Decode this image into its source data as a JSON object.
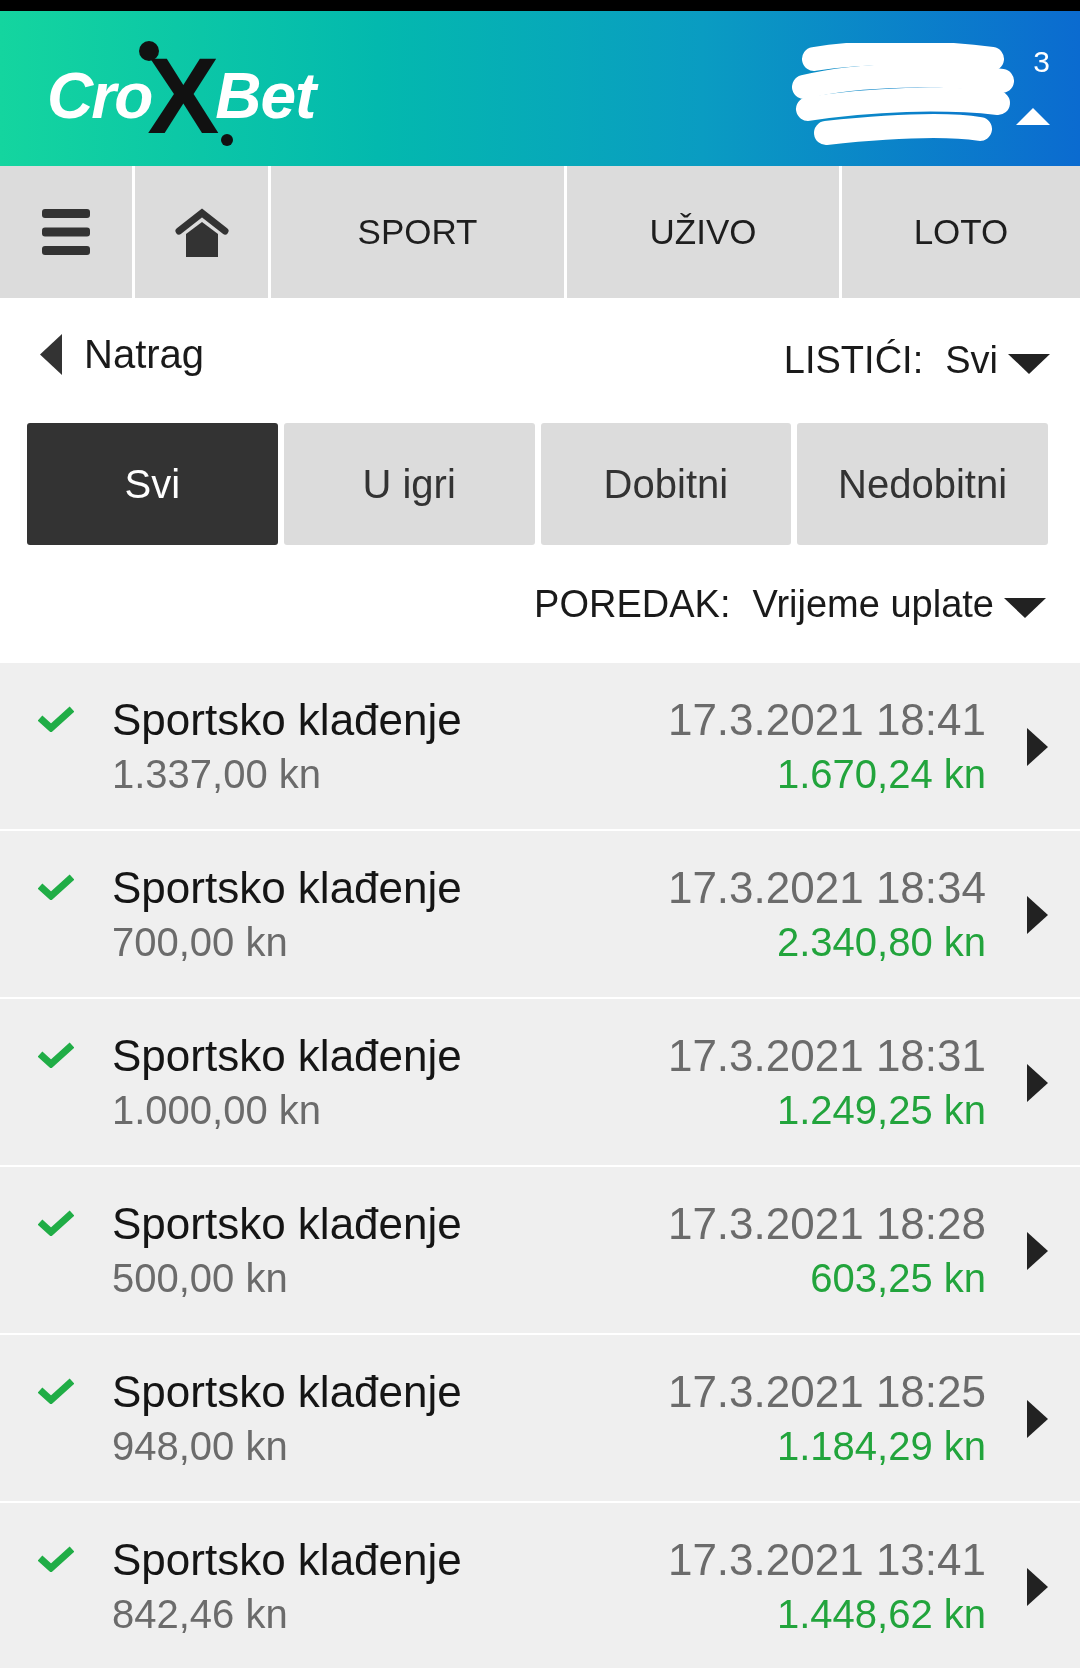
{
  "header": {
    "logo": {
      "prefix": "Cro",
      "mark": "X",
      "suffix": "Bet"
    },
    "redacted_account": {
      "visible_text": "3"
    }
  },
  "nav": [
    {
      "kind": "menu"
    },
    {
      "kind": "home"
    },
    {
      "kind": "link",
      "label": "SPORT"
    },
    {
      "kind": "link",
      "label": "UŽIVO"
    },
    {
      "kind": "link",
      "label": "LOTO"
    }
  ],
  "back": {
    "label": "Natrag"
  },
  "slip_filter": {
    "label": "LISTIĆI:",
    "value": "Svi"
  },
  "filter_tabs": [
    {
      "label": "Svi",
      "selected": true
    },
    {
      "label": "U igri",
      "selected": false
    },
    {
      "label": "Dobitni",
      "selected": false
    },
    {
      "label": "Nedobitni",
      "selected": false
    }
  ],
  "sort": {
    "label": "POREDAK:",
    "value": "Vrijeme uplate"
  },
  "slips": [
    {
      "title": "Sportsko klađenje",
      "stake": "1.337,00 kn",
      "time": "17.3.2021 18:41",
      "payout": "1.670,24 kn",
      "won": true
    },
    {
      "title": "Sportsko klađenje",
      "stake": "700,00 kn",
      "time": "17.3.2021 18:34",
      "payout": "2.340,80 kn",
      "won": true
    },
    {
      "title": "Sportsko klađenje",
      "stake": "1.000,00 kn",
      "time": "17.3.2021 18:31",
      "payout": "1.249,25 kn",
      "won": true
    },
    {
      "title": "Sportsko klađenje",
      "stake": "500,00 kn",
      "time": "17.3.2021 18:28",
      "payout": "603,25 kn",
      "won": true
    },
    {
      "title": "Sportsko klađenje",
      "stake": "948,00 kn",
      "time": "17.3.2021 18:25",
      "payout": "1.184,29 kn",
      "won": true
    },
    {
      "title": "Sportsko klađenje",
      "stake": "842,46 kn",
      "time": "17.3.2021 13:41",
      "payout": "1.448,62 kn",
      "won": true
    }
  ]
}
